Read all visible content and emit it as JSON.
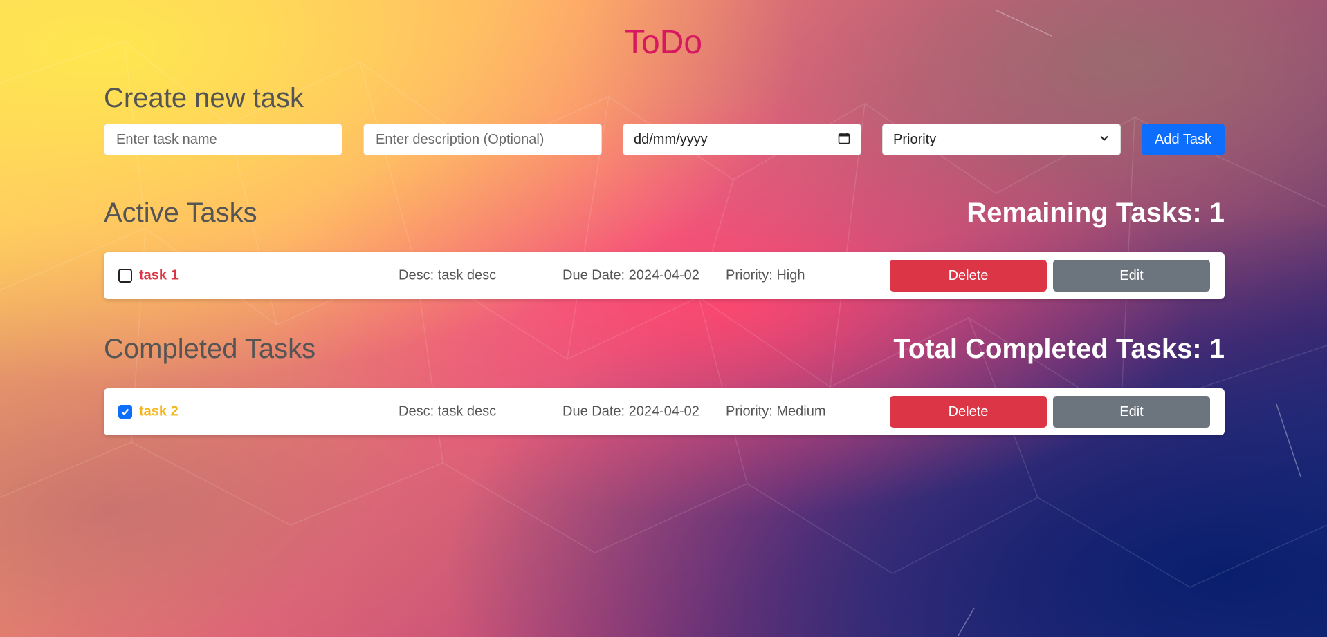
{
  "app": {
    "title": "ToDo"
  },
  "create": {
    "heading": "Create new task",
    "name_placeholder": "Enter task name",
    "desc_placeholder": "Enter description (Optional)",
    "date_placeholder": "dd/mm/yyyy",
    "priority_selected": "Priority",
    "add_label": "Add Task"
  },
  "active": {
    "heading": "Active Tasks",
    "count_label": "Remaining Tasks: 1",
    "tasks": [
      {
        "name": "task 1",
        "desc": "Desc: task desc",
        "due": "Due Date: 2024-04-02",
        "priority": "Priority: High",
        "delete_label": "Delete",
        "edit_label": "Edit"
      }
    ]
  },
  "completed": {
    "heading": "Completed Tasks",
    "count_label": "Total Completed Tasks: 1",
    "tasks": [
      {
        "name": "task 2",
        "desc": "Desc: task desc",
        "due": "Due Date: 2024-04-02",
        "priority": "Priority: Medium",
        "delete_label": "Delete",
        "edit_label": "Edit"
      }
    ]
  },
  "colors": {
    "title": "#d6185e",
    "primary": "#0d6efd",
    "danger": "#dc3545",
    "secondary": "#6c757d",
    "active_name": "#dc3545",
    "completed_name": "#f4b61a"
  },
  "icons": {
    "date": "calendar-icon",
    "select": "chevron-down-icon",
    "checked": "checkmark-icon"
  }
}
